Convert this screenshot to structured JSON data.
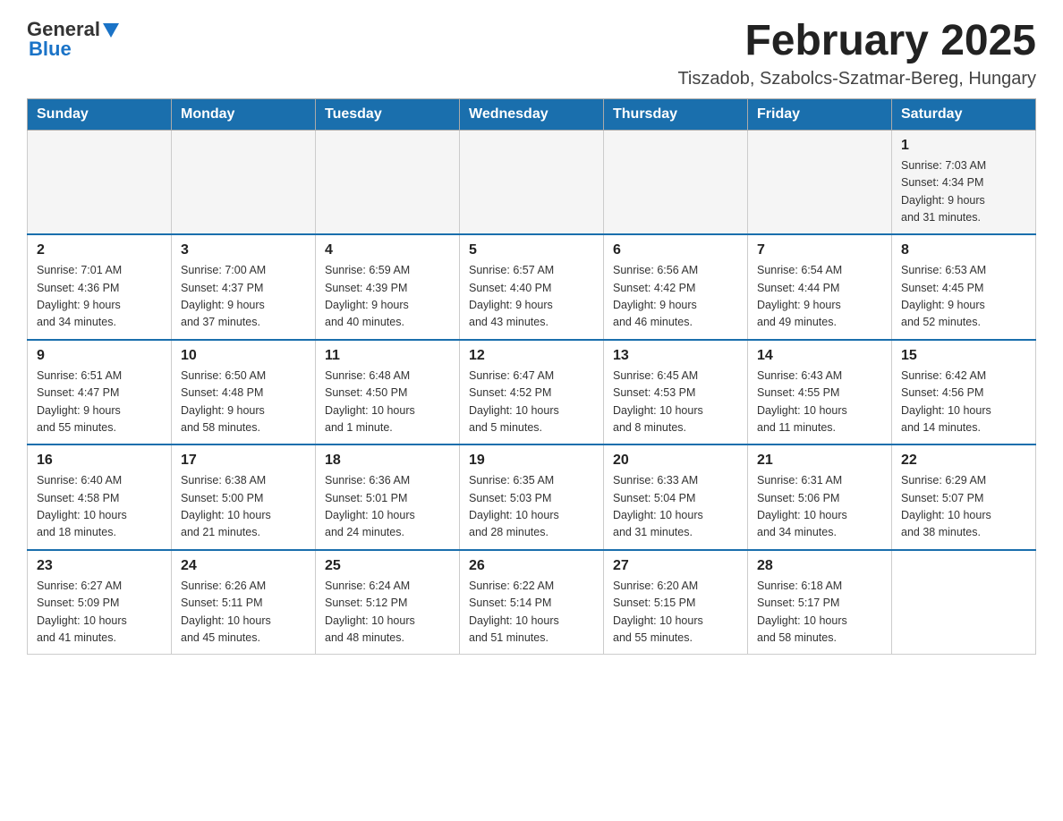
{
  "header": {
    "logo": {
      "general": "General",
      "blue": "Blue"
    },
    "title": "February 2025",
    "subtitle": "Tiszadob, Szabolcs-Szatmar-Bereg, Hungary"
  },
  "weekdays": [
    "Sunday",
    "Monday",
    "Tuesday",
    "Wednesday",
    "Thursday",
    "Friday",
    "Saturday"
  ],
  "weeks": [
    [
      {
        "day": "",
        "info": ""
      },
      {
        "day": "",
        "info": ""
      },
      {
        "day": "",
        "info": ""
      },
      {
        "day": "",
        "info": ""
      },
      {
        "day": "",
        "info": ""
      },
      {
        "day": "",
        "info": ""
      },
      {
        "day": "1",
        "info": "Sunrise: 7:03 AM\nSunset: 4:34 PM\nDaylight: 9 hours\nand 31 minutes."
      }
    ],
    [
      {
        "day": "2",
        "info": "Sunrise: 7:01 AM\nSunset: 4:36 PM\nDaylight: 9 hours\nand 34 minutes."
      },
      {
        "day": "3",
        "info": "Sunrise: 7:00 AM\nSunset: 4:37 PM\nDaylight: 9 hours\nand 37 minutes."
      },
      {
        "day": "4",
        "info": "Sunrise: 6:59 AM\nSunset: 4:39 PM\nDaylight: 9 hours\nand 40 minutes."
      },
      {
        "day": "5",
        "info": "Sunrise: 6:57 AM\nSunset: 4:40 PM\nDaylight: 9 hours\nand 43 minutes."
      },
      {
        "day": "6",
        "info": "Sunrise: 6:56 AM\nSunset: 4:42 PM\nDaylight: 9 hours\nand 46 minutes."
      },
      {
        "day": "7",
        "info": "Sunrise: 6:54 AM\nSunset: 4:44 PM\nDaylight: 9 hours\nand 49 minutes."
      },
      {
        "day": "8",
        "info": "Sunrise: 6:53 AM\nSunset: 4:45 PM\nDaylight: 9 hours\nand 52 minutes."
      }
    ],
    [
      {
        "day": "9",
        "info": "Sunrise: 6:51 AM\nSunset: 4:47 PM\nDaylight: 9 hours\nand 55 minutes."
      },
      {
        "day": "10",
        "info": "Sunrise: 6:50 AM\nSunset: 4:48 PM\nDaylight: 9 hours\nand 58 minutes."
      },
      {
        "day": "11",
        "info": "Sunrise: 6:48 AM\nSunset: 4:50 PM\nDaylight: 10 hours\nand 1 minute."
      },
      {
        "day": "12",
        "info": "Sunrise: 6:47 AM\nSunset: 4:52 PM\nDaylight: 10 hours\nand 5 minutes."
      },
      {
        "day": "13",
        "info": "Sunrise: 6:45 AM\nSunset: 4:53 PM\nDaylight: 10 hours\nand 8 minutes."
      },
      {
        "day": "14",
        "info": "Sunrise: 6:43 AM\nSunset: 4:55 PM\nDaylight: 10 hours\nand 11 minutes."
      },
      {
        "day": "15",
        "info": "Sunrise: 6:42 AM\nSunset: 4:56 PM\nDaylight: 10 hours\nand 14 minutes."
      }
    ],
    [
      {
        "day": "16",
        "info": "Sunrise: 6:40 AM\nSunset: 4:58 PM\nDaylight: 10 hours\nand 18 minutes."
      },
      {
        "day": "17",
        "info": "Sunrise: 6:38 AM\nSunset: 5:00 PM\nDaylight: 10 hours\nand 21 minutes."
      },
      {
        "day": "18",
        "info": "Sunrise: 6:36 AM\nSunset: 5:01 PM\nDaylight: 10 hours\nand 24 minutes."
      },
      {
        "day": "19",
        "info": "Sunrise: 6:35 AM\nSunset: 5:03 PM\nDaylight: 10 hours\nand 28 minutes."
      },
      {
        "day": "20",
        "info": "Sunrise: 6:33 AM\nSunset: 5:04 PM\nDaylight: 10 hours\nand 31 minutes."
      },
      {
        "day": "21",
        "info": "Sunrise: 6:31 AM\nSunset: 5:06 PM\nDaylight: 10 hours\nand 34 minutes."
      },
      {
        "day": "22",
        "info": "Sunrise: 6:29 AM\nSunset: 5:07 PM\nDaylight: 10 hours\nand 38 minutes."
      }
    ],
    [
      {
        "day": "23",
        "info": "Sunrise: 6:27 AM\nSunset: 5:09 PM\nDaylight: 10 hours\nand 41 minutes."
      },
      {
        "day": "24",
        "info": "Sunrise: 6:26 AM\nSunset: 5:11 PM\nDaylight: 10 hours\nand 45 minutes."
      },
      {
        "day": "25",
        "info": "Sunrise: 6:24 AM\nSunset: 5:12 PM\nDaylight: 10 hours\nand 48 minutes."
      },
      {
        "day": "26",
        "info": "Sunrise: 6:22 AM\nSunset: 5:14 PM\nDaylight: 10 hours\nand 51 minutes."
      },
      {
        "day": "27",
        "info": "Sunrise: 6:20 AM\nSunset: 5:15 PM\nDaylight: 10 hours\nand 55 minutes."
      },
      {
        "day": "28",
        "info": "Sunrise: 6:18 AM\nSunset: 5:17 PM\nDaylight: 10 hours\nand 58 minutes."
      },
      {
        "day": "",
        "info": ""
      }
    ]
  ]
}
